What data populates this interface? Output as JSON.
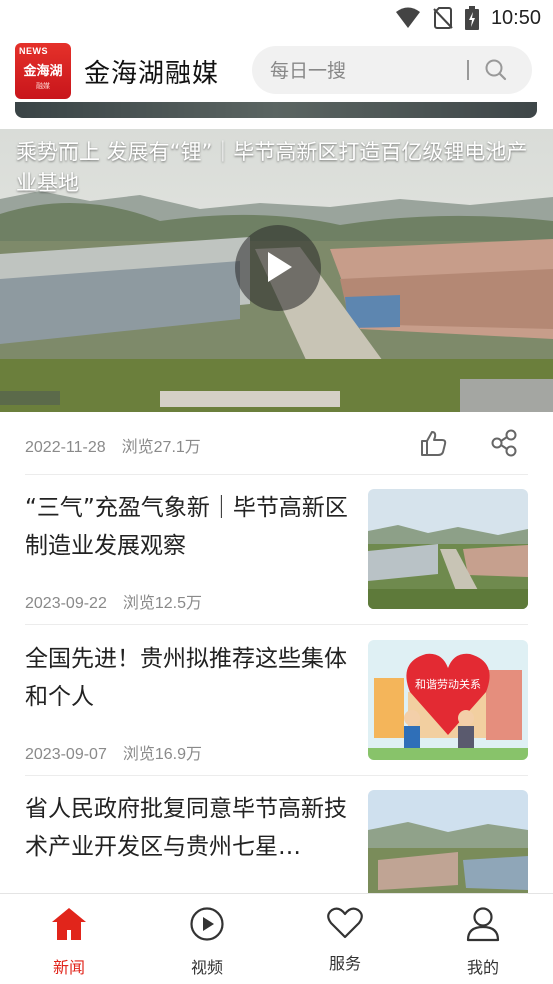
{
  "status_bar": {
    "time": "10:50",
    "icons": [
      "wifi-icon",
      "no-sim-icon",
      "battery-icon"
    ]
  },
  "header": {
    "logo": {
      "top": "NEWS",
      "main": "金海湖",
      "sub": "融媒"
    },
    "title": "金海湖融媒",
    "search": {
      "placeholder": "每日一搜"
    }
  },
  "colors": {
    "accent": "#e1251b",
    "meta_text": "#8a8a8a"
  },
  "featured": {
    "title": "乘势而上 发展有“锂”｜毕节高新区打造百亿级锂电池产业基地",
    "date": "2022-11-28",
    "views": "浏览27.1万"
  },
  "news": [
    {
      "title": "“三气”充盈气象新｜毕节高新区制造业发展观察",
      "date": "2023-09-22",
      "views": "浏览12.5万"
    },
    {
      "title": "全国先进！贵州拟推荐这些集体和个人",
      "date": "2023-09-07",
      "views": "浏览16.9万",
      "image_text": "和谐劳动关系"
    },
    {
      "title": "省人民政府批复同意毕节高新技术产业开发区与贵州七星…",
      "date": "",
      "views": ""
    }
  ],
  "tabs": [
    {
      "label": "新闻",
      "icon": "home-icon",
      "active": true
    },
    {
      "label": "视频",
      "icon": "play-circle-icon",
      "active": false
    },
    {
      "label": "服务",
      "icon": "heart-icon",
      "active": false
    },
    {
      "label": "我的",
      "icon": "user-icon",
      "active": false
    }
  ]
}
